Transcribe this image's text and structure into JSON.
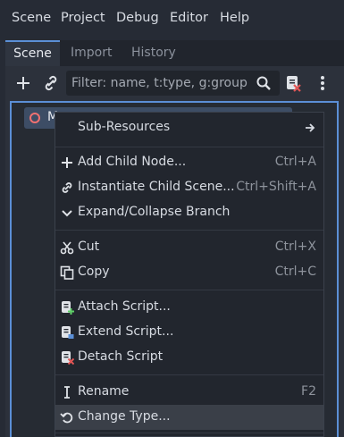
{
  "menubar": {
    "items": [
      "Scene",
      "Project",
      "Debug",
      "Editor",
      "Help"
    ]
  },
  "dock": {
    "tabs": [
      "Scene",
      "Import",
      "History"
    ],
    "filter_placeholder": "Filter: name, t:type, g:group"
  },
  "tree": {
    "root_label": "M"
  },
  "context_menu": {
    "sub_resources": "Sub-Resources",
    "add_child": {
      "label": "Add Child Node...",
      "shortcut": "Ctrl+A"
    },
    "instantiate": {
      "label": "Instantiate Child Scene...",
      "shortcut": "Ctrl+Shift+A"
    },
    "expand": {
      "label": "Expand/Collapse Branch"
    },
    "cut": {
      "label": "Cut",
      "shortcut": "Ctrl+X"
    },
    "copy": {
      "label": "Copy",
      "shortcut": "Ctrl+C"
    },
    "attach_script": {
      "label": "Attach Script..."
    },
    "extend_script": {
      "label": "Extend Script..."
    },
    "detach_script": {
      "label": "Detach Script"
    },
    "rename": {
      "label": "Rename",
      "shortcut": "F2"
    },
    "change_type": {
      "label": "Change Type..."
    }
  },
  "colors": {
    "accent": "#5b8fd6",
    "background": "#262b35",
    "menu_bg": "#22262e",
    "highlight": "#3a3f48"
  }
}
